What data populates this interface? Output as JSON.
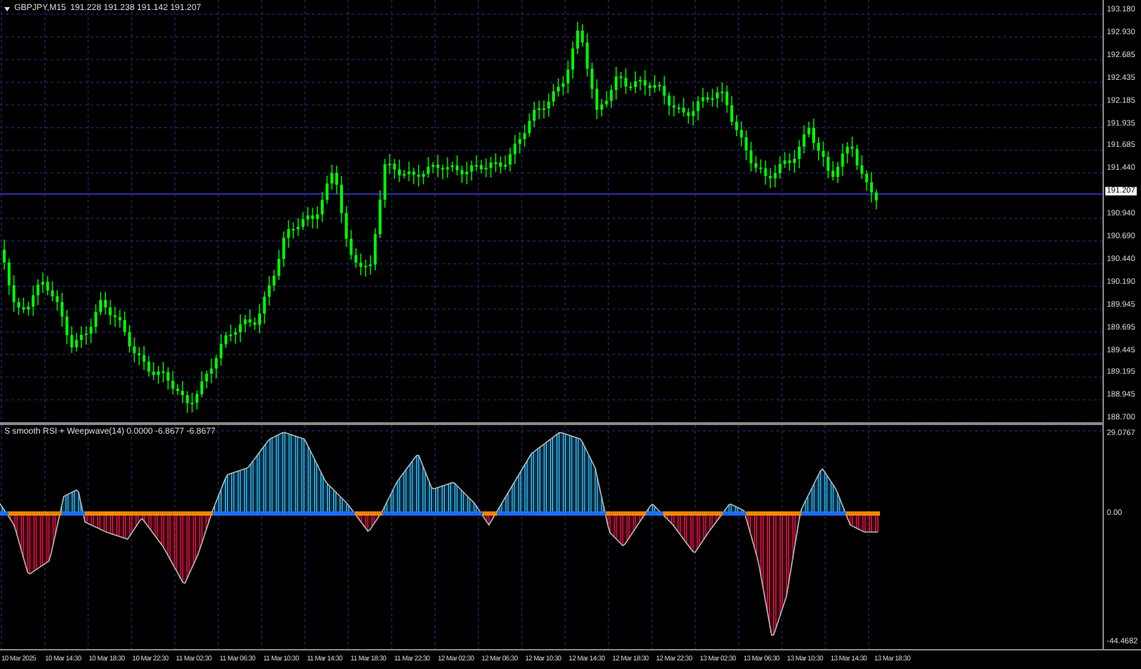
{
  "chart_header": {
    "symbol": "GBPJPY,M15",
    "ohlc": "191.228 191.238 191.142 191.207"
  },
  "price_axis": {
    "labels": [
      "193.180",
      "192.930",
      "192.685",
      "192.435",
      "192.185",
      "191.935",
      "191.685",
      "191.440",
      "190.940",
      "190.690",
      "190.440",
      "190.190",
      "189.945",
      "189.695",
      "189.445",
      "189.195",
      "188.945",
      "188.700"
    ]
  },
  "current_price": "191.207",
  "indicator": {
    "title": "S smooth RSI + Weepwave(14) 0.0000 -6.8677 -6.8677",
    "axis_labels": [
      "29.0767",
      "0.00",
      "-44.4682"
    ]
  },
  "time_axis": {
    "labels": [
      "10 Mar 2025",
      "10 Mar 14:30",
      "10 Mar 18:30",
      "10 Mar 22:30",
      "11 Mar 02:30",
      "11 Mar 06:30",
      "11 Mar 10:30",
      "11 Mar 14:30",
      "11 Mar 18:30",
      "11 Mar 22:30",
      "12 Mar 02:30",
      "12 Mar 06:30",
      "12 Mar 10:30",
      "12 Mar 14:30",
      "12 Mar 18:30",
      "12 Mar 22:30",
      "13 Mar 02:30",
      "13 Mar 06:30",
      "13 Mar 10:30",
      "13 Mar 14:30",
      "13 Mar 18:30"
    ]
  }
}
